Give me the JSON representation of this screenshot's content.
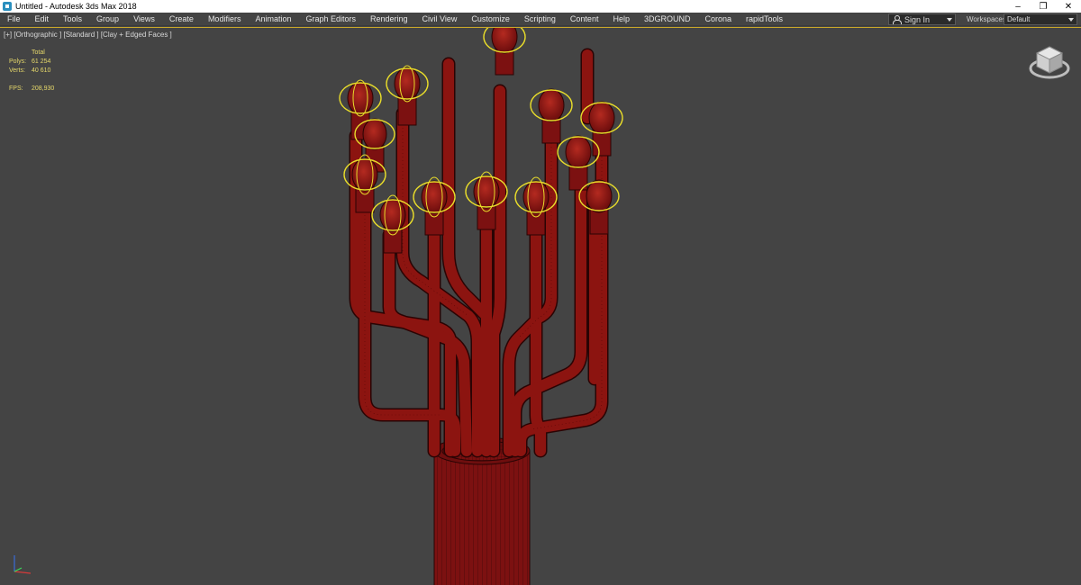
{
  "window": {
    "title": "Untitled - Autodesk 3ds Max 2018",
    "controls": [
      "–",
      "❐",
      "✕"
    ]
  },
  "menu": {
    "items": [
      "File",
      "Edit",
      "Tools",
      "Group",
      "Views",
      "Create",
      "Modifiers",
      "Animation",
      "Graph Editors",
      "Rendering",
      "Civil View",
      "Customize",
      "Scripting",
      "Content",
      "Help",
      "3DGROUND",
      "Corona",
      "rapidTools"
    ],
    "sign_in": "Sign In",
    "workspaces_label": "Workspaces:",
    "workspace_value": "Default"
  },
  "viewport": {
    "label": "[+] [Orthographic ] [Standard ] [Clay + Edged Faces ]",
    "stats": {
      "total_label": "Total",
      "polys_label": "Polys:",
      "polys_value": "61 254",
      "verts_label": "Verts:",
      "verts_value": "40 610",
      "fps_label": "FPS:",
      "fps_value": "208,930"
    }
  },
  "colors": {
    "mesh": "#7a1010",
    "mesh_light": "#a01b16",
    "selection": "#e8dc2a",
    "viewport_bg": "#444444"
  },
  "icons": {
    "app": "3dsmax-icon",
    "user": "user-icon",
    "viewcube": "viewcube-icon",
    "axis": "axis-tripod-icon"
  }
}
